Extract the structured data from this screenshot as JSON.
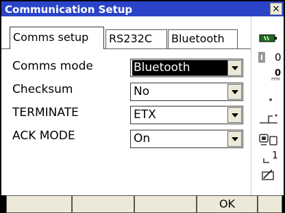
{
  "window": {
    "title": "Communication Setup",
    "close_glyph": "×"
  },
  "tabs": [
    {
      "label": "Comms setup",
      "active": true
    },
    {
      "label": "RS232C",
      "active": false
    },
    {
      "label": "Bluetooth",
      "active": false
    }
  ],
  "fields": [
    {
      "label": "Comms mode",
      "value": "Bluetooth",
      "focused": true
    },
    {
      "label": "Checksum",
      "value": "No",
      "focused": false
    },
    {
      "label": "TERMINATE",
      "value": "ETX",
      "focused": false
    },
    {
      "label": "ACK MODE",
      "value": "On",
      "focused": false
    }
  ],
  "status": {
    "battery_icon": "battery-icon",
    "target_icon": "prism-icon",
    "target_constant": "0",
    "ppm_value": "0",
    "ppm_unit": "PPM",
    "tilt_icon": "tilt-icon",
    "comm_icon": "communication-icon",
    "input_mode_icon": "input-mode-icon",
    "input_mode_value": "1",
    "sip_icon": "keyboard-pen-icon"
  },
  "softkeys": [
    "",
    "",
    "",
    "OK",
    ""
  ],
  "colors": {
    "title_bar": "#2a44c8",
    "focus_bg": "#000000",
    "button_face": "#ece9d8"
  }
}
